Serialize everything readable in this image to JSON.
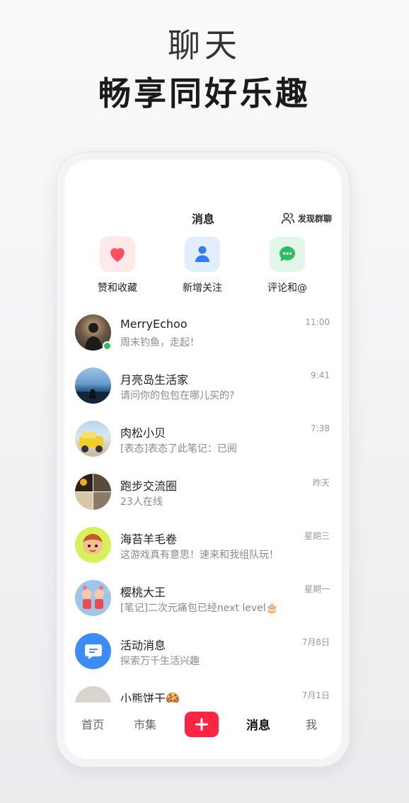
{
  "hero": {
    "title": "聊天",
    "subtitle": "畅享同好乐趣"
  },
  "header": {
    "title": "消息",
    "discover_group": "发现群聊"
  },
  "quick_actions": [
    {
      "label": "赞和收藏",
      "icon": "heart-icon",
      "color": "#ff4d5e",
      "bg": "#fde8ea"
    },
    {
      "label": "新增关注",
      "icon": "person-icon",
      "color": "#2f7cf6",
      "bg": "#e3eefd"
    },
    {
      "label": "评论和@",
      "icon": "chat-bubble-icon",
      "color": "#2cc062",
      "bg": "#e3f6ea"
    }
  ],
  "conversations": [
    {
      "name": "MerryEchoo",
      "preview": "周末钓鱼，走起！",
      "time": "11:00",
      "online": true
    },
    {
      "name": "月亮岛生活家",
      "preview": "请问你的包包在哪儿买的?",
      "time": "9:41"
    },
    {
      "name": "肉松小贝",
      "preview": "[表态]表态了此笔记：已阅",
      "time": "7:38"
    },
    {
      "name": "跑步交流圈",
      "preview": "23人在线",
      "time": "昨天"
    },
    {
      "name": "海苔羊毛卷",
      "preview": "这游戏真有意思！速来和我组队玩！",
      "time": "星期三"
    },
    {
      "name": "樱桃大王",
      "preview": "[笔记]二次元痛包已经next level🎂",
      "time": "星期一"
    },
    {
      "name": "活动消息",
      "preview": "探索万千生活兴趣",
      "time": "7月8日"
    },
    {
      "name": "小熊饼干🍪",
      "preview": "",
      "time": "7月1日"
    }
  ],
  "tabbar": {
    "home": "首页",
    "market": "市集",
    "messages": "消息",
    "me": "我"
  },
  "colors": {
    "accent": "#ff2442",
    "online": "#2fc25b"
  }
}
